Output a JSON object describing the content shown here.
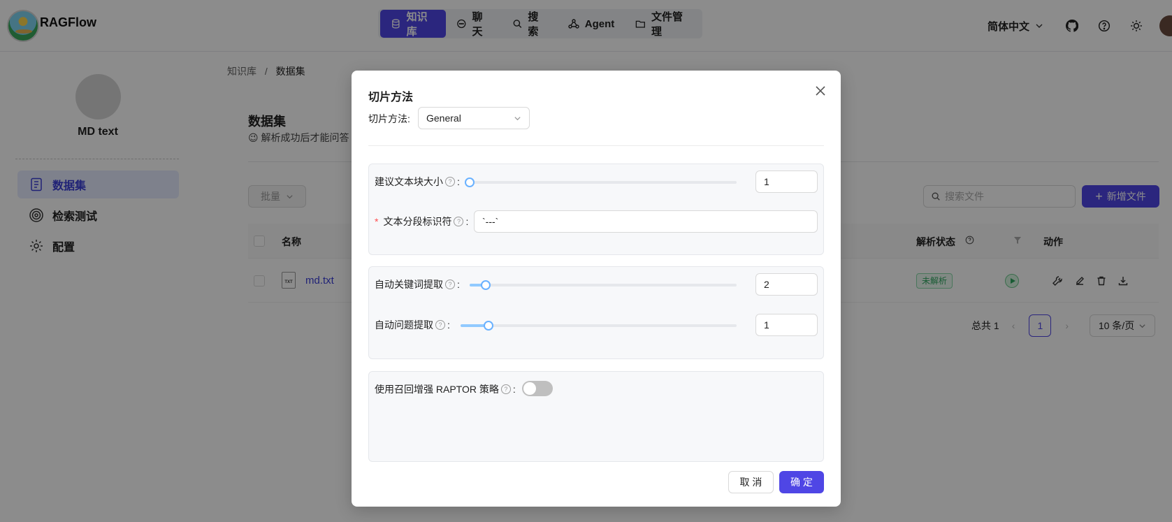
{
  "app": {
    "brand": "RAGFlow"
  },
  "nav": {
    "items": [
      {
        "label": "知识库",
        "icon": "database-icon",
        "active": true
      },
      {
        "label": "聊天",
        "icon": "chat-icon"
      },
      {
        "label": "搜索",
        "icon": "search-icon"
      },
      {
        "label": "Agent",
        "icon": "agent-icon"
      },
      {
        "label": "文件管理",
        "icon": "folder-icon"
      }
    ]
  },
  "header": {
    "language": "简体中文"
  },
  "sidebar": {
    "kb_name": "MD text",
    "items": [
      {
        "label": "数据集",
        "icon": "document-icon",
        "active": true
      },
      {
        "label": "检索测试",
        "icon": "target-icon"
      },
      {
        "label": "配置",
        "icon": "gear-icon"
      }
    ]
  },
  "breadcrumb": {
    "root": "知识库",
    "separator": "/",
    "current": "数据集"
  },
  "dataset": {
    "title": "数据集",
    "desc": "😉 解析成功后才能问答",
    "bulk_label": "批量",
    "search_placeholder": "搜索文件",
    "add_label": "新增文件",
    "columns": {
      "name": "名称",
      "status": "解析状态",
      "action": "动作"
    },
    "rows": [
      {
        "name": "md.txt",
        "file_type": "TXT",
        "status": "未解析"
      }
    ],
    "pagination": {
      "total": "总共 1",
      "page": "1",
      "page_size": "10 条/页"
    }
  },
  "modal": {
    "title": "切片方法",
    "method_label": "切片方法:",
    "method_value": "General",
    "chunk_size": {
      "label": "建议文本块大小",
      "value": "1",
      "level": 0.0
    },
    "delimiter": {
      "label": "文本分段标识符",
      "value": "`---`"
    },
    "keywords": {
      "label": "自动关键词提取",
      "value": "2",
      "level": 0.06
    },
    "questions": {
      "label": "自动问题提取",
      "value": "1",
      "level": 0.1
    },
    "raptor": {
      "label": "使用召回增强 RAPTOR 策略",
      "enabled": false
    },
    "cancel_label": "取 消",
    "ok_label": "确 定"
  },
  "colors": {
    "accent": "#4f46e5",
    "success": "#2fa660",
    "slider": "#91caff"
  }
}
